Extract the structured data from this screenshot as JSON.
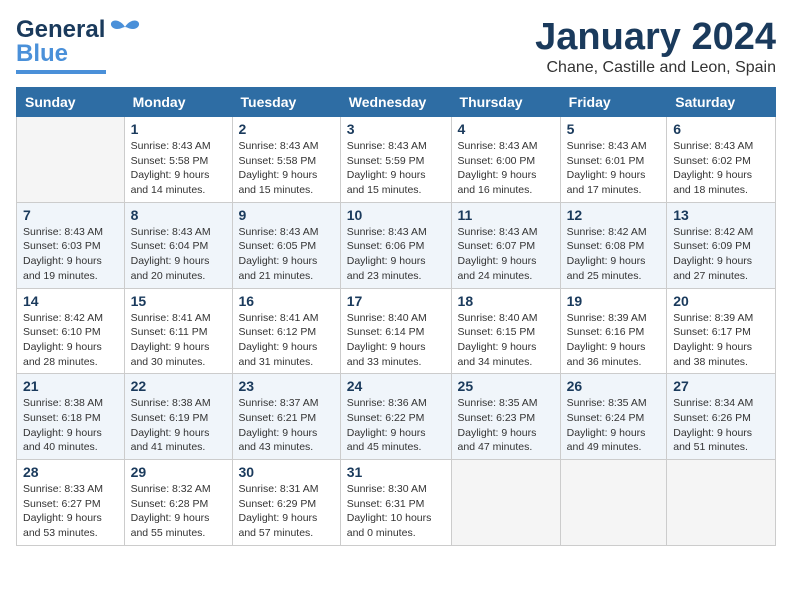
{
  "logo": {
    "text_general": "General",
    "text_blue": "Blue"
  },
  "header": {
    "month_title": "January 2024",
    "subtitle": "Chane, Castille and Leon, Spain"
  },
  "days_of_week": [
    "Sunday",
    "Monday",
    "Tuesday",
    "Wednesday",
    "Thursday",
    "Friday",
    "Saturday"
  ],
  "weeks": [
    [
      {
        "day": "",
        "sunrise": "",
        "sunset": "",
        "daylight": ""
      },
      {
        "day": "1",
        "sunrise": "Sunrise: 8:43 AM",
        "sunset": "Sunset: 5:58 PM",
        "daylight": "Daylight: 9 hours and 14 minutes."
      },
      {
        "day": "2",
        "sunrise": "Sunrise: 8:43 AM",
        "sunset": "Sunset: 5:58 PM",
        "daylight": "Daylight: 9 hours and 15 minutes."
      },
      {
        "day": "3",
        "sunrise": "Sunrise: 8:43 AM",
        "sunset": "Sunset: 5:59 PM",
        "daylight": "Daylight: 9 hours and 15 minutes."
      },
      {
        "day": "4",
        "sunrise": "Sunrise: 8:43 AM",
        "sunset": "Sunset: 6:00 PM",
        "daylight": "Daylight: 9 hours and 16 minutes."
      },
      {
        "day": "5",
        "sunrise": "Sunrise: 8:43 AM",
        "sunset": "Sunset: 6:01 PM",
        "daylight": "Daylight: 9 hours and 17 minutes."
      },
      {
        "day": "6",
        "sunrise": "Sunrise: 8:43 AM",
        "sunset": "Sunset: 6:02 PM",
        "daylight": "Daylight: 9 hours and 18 minutes."
      }
    ],
    [
      {
        "day": "7",
        "sunrise": "Sunrise: 8:43 AM",
        "sunset": "Sunset: 6:03 PM",
        "daylight": "Daylight: 9 hours and 19 minutes."
      },
      {
        "day": "8",
        "sunrise": "Sunrise: 8:43 AM",
        "sunset": "Sunset: 6:04 PM",
        "daylight": "Daylight: 9 hours and 20 minutes."
      },
      {
        "day": "9",
        "sunrise": "Sunrise: 8:43 AM",
        "sunset": "Sunset: 6:05 PM",
        "daylight": "Daylight: 9 hours and 21 minutes."
      },
      {
        "day": "10",
        "sunrise": "Sunrise: 8:43 AM",
        "sunset": "Sunset: 6:06 PM",
        "daylight": "Daylight: 9 hours and 23 minutes."
      },
      {
        "day": "11",
        "sunrise": "Sunrise: 8:43 AM",
        "sunset": "Sunset: 6:07 PM",
        "daylight": "Daylight: 9 hours and 24 minutes."
      },
      {
        "day": "12",
        "sunrise": "Sunrise: 8:42 AM",
        "sunset": "Sunset: 6:08 PM",
        "daylight": "Daylight: 9 hours and 25 minutes."
      },
      {
        "day": "13",
        "sunrise": "Sunrise: 8:42 AM",
        "sunset": "Sunset: 6:09 PM",
        "daylight": "Daylight: 9 hours and 27 minutes."
      }
    ],
    [
      {
        "day": "14",
        "sunrise": "Sunrise: 8:42 AM",
        "sunset": "Sunset: 6:10 PM",
        "daylight": "Daylight: 9 hours and 28 minutes."
      },
      {
        "day": "15",
        "sunrise": "Sunrise: 8:41 AM",
        "sunset": "Sunset: 6:11 PM",
        "daylight": "Daylight: 9 hours and 30 minutes."
      },
      {
        "day": "16",
        "sunrise": "Sunrise: 8:41 AM",
        "sunset": "Sunset: 6:12 PM",
        "daylight": "Daylight: 9 hours and 31 minutes."
      },
      {
        "day": "17",
        "sunrise": "Sunrise: 8:40 AM",
        "sunset": "Sunset: 6:14 PM",
        "daylight": "Daylight: 9 hours and 33 minutes."
      },
      {
        "day": "18",
        "sunrise": "Sunrise: 8:40 AM",
        "sunset": "Sunset: 6:15 PM",
        "daylight": "Daylight: 9 hours and 34 minutes."
      },
      {
        "day": "19",
        "sunrise": "Sunrise: 8:39 AM",
        "sunset": "Sunset: 6:16 PM",
        "daylight": "Daylight: 9 hours and 36 minutes."
      },
      {
        "day": "20",
        "sunrise": "Sunrise: 8:39 AM",
        "sunset": "Sunset: 6:17 PM",
        "daylight": "Daylight: 9 hours and 38 minutes."
      }
    ],
    [
      {
        "day": "21",
        "sunrise": "Sunrise: 8:38 AM",
        "sunset": "Sunset: 6:18 PM",
        "daylight": "Daylight: 9 hours and 40 minutes."
      },
      {
        "day": "22",
        "sunrise": "Sunrise: 8:38 AM",
        "sunset": "Sunset: 6:19 PM",
        "daylight": "Daylight: 9 hours and 41 minutes."
      },
      {
        "day": "23",
        "sunrise": "Sunrise: 8:37 AM",
        "sunset": "Sunset: 6:21 PM",
        "daylight": "Daylight: 9 hours and 43 minutes."
      },
      {
        "day": "24",
        "sunrise": "Sunrise: 8:36 AM",
        "sunset": "Sunset: 6:22 PM",
        "daylight": "Daylight: 9 hours and 45 minutes."
      },
      {
        "day": "25",
        "sunrise": "Sunrise: 8:35 AM",
        "sunset": "Sunset: 6:23 PM",
        "daylight": "Daylight: 9 hours and 47 minutes."
      },
      {
        "day": "26",
        "sunrise": "Sunrise: 8:35 AM",
        "sunset": "Sunset: 6:24 PM",
        "daylight": "Daylight: 9 hours and 49 minutes."
      },
      {
        "day": "27",
        "sunrise": "Sunrise: 8:34 AM",
        "sunset": "Sunset: 6:26 PM",
        "daylight": "Daylight: 9 hours and 51 minutes."
      }
    ],
    [
      {
        "day": "28",
        "sunrise": "Sunrise: 8:33 AM",
        "sunset": "Sunset: 6:27 PM",
        "daylight": "Daylight: 9 hours and 53 minutes."
      },
      {
        "day": "29",
        "sunrise": "Sunrise: 8:32 AM",
        "sunset": "Sunset: 6:28 PM",
        "daylight": "Daylight: 9 hours and 55 minutes."
      },
      {
        "day": "30",
        "sunrise": "Sunrise: 8:31 AM",
        "sunset": "Sunset: 6:29 PM",
        "daylight": "Daylight: 9 hours and 57 minutes."
      },
      {
        "day": "31",
        "sunrise": "Sunrise: 8:30 AM",
        "sunset": "Sunset: 6:31 PM",
        "daylight": "Daylight: 10 hours and 0 minutes."
      },
      {
        "day": "",
        "sunrise": "",
        "sunset": "",
        "daylight": ""
      },
      {
        "day": "",
        "sunrise": "",
        "sunset": "",
        "daylight": ""
      },
      {
        "day": "",
        "sunrise": "",
        "sunset": "",
        "daylight": ""
      }
    ]
  ]
}
